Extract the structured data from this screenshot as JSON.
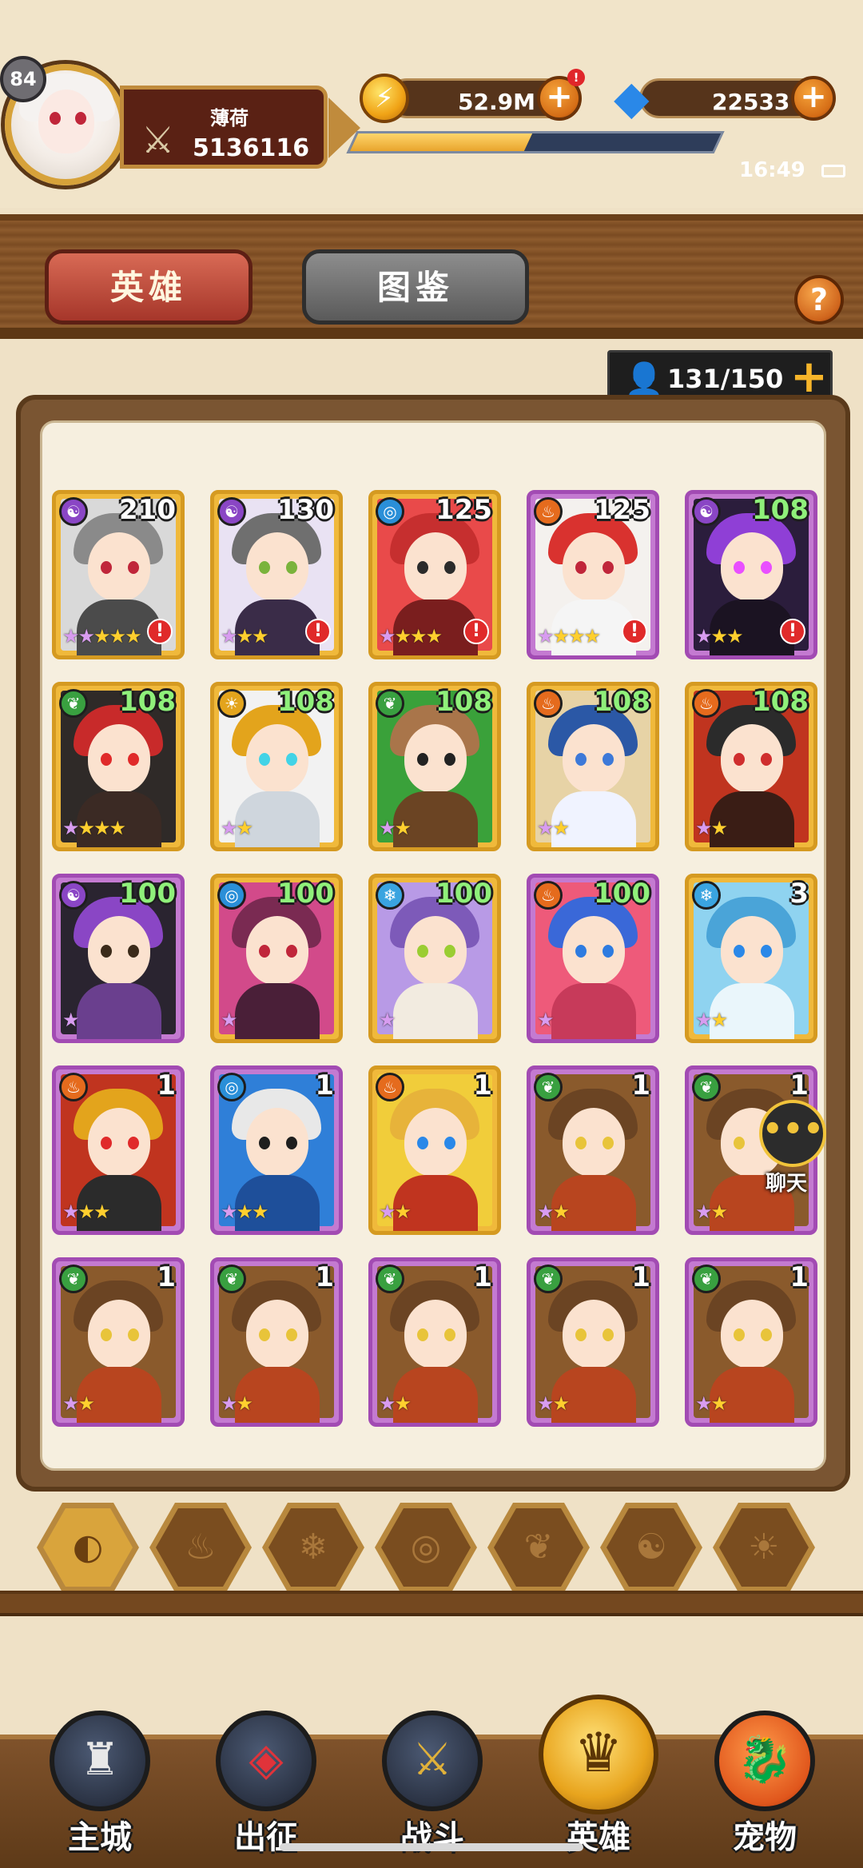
{
  "player": {
    "level": "84",
    "name": "薄荷",
    "power": "5136116"
  },
  "resources": {
    "gold": "52.9M",
    "gold_alert": "!",
    "gems": "22533",
    "exp_progress": 0.48
  },
  "status_bar": {
    "time": "16:49"
  },
  "tabs": {
    "heroes": "英雄",
    "codex": "图鉴",
    "help": "?"
  },
  "roster": {
    "count": "131/150",
    "plus": "+"
  },
  "heroes": [
    {
      "level": "210",
      "element": "dark",
      "stars": "2p3g",
      "alert": true
    },
    {
      "level": "130",
      "element": "dark",
      "stars": "1p2g",
      "alert": true
    },
    {
      "level": "125",
      "element": "water",
      "stars": "1p3g",
      "alert": true
    },
    {
      "level": "125",
      "element": "fire",
      "stars": "1p3g",
      "alert": true
    },
    {
      "level": "108",
      "element": "dark",
      "stars": "1p2g",
      "alert": true
    },
    {
      "level": "108",
      "element": "nature",
      "stars": "1p3g",
      "alert": false
    },
    {
      "level": "108",
      "element": "light",
      "stars": "1p1g",
      "alert": false
    },
    {
      "level": "108",
      "element": "nature",
      "stars": "1p1g",
      "alert": false
    },
    {
      "level": "108",
      "element": "fire",
      "stars": "1p1g",
      "alert": false
    },
    {
      "level": "108",
      "element": "fire",
      "stars": "1p1g",
      "alert": false
    },
    {
      "level": "100",
      "element": "dark",
      "stars": "1p",
      "alert": false
    },
    {
      "level": "100",
      "element": "water",
      "stars": "1p",
      "alert": false
    },
    {
      "level": "100",
      "element": "ice",
      "stars": "1p",
      "alert": false
    },
    {
      "level": "100",
      "element": "fire",
      "stars": "1p",
      "alert": false
    },
    {
      "level": "3",
      "element": "ice",
      "stars": "1p1g",
      "alert": false
    },
    {
      "level": "1",
      "element": "fire",
      "stars": "1p2g",
      "alert": false
    },
    {
      "level": "1",
      "element": "water",
      "stars": "1p2g",
      "alert": false
    },
    {
      "level": "1",
      "element": "fire",
      "stars": "1p1g",
      "alert": false
    },
    {
      "level": "1",
      "element": "nature",
      "stars": "1p1g",
      "alert": false
    },
    {
      "level": "1",
      "element": "nature",
      "stars": "1p1g",
      "alert": false
    },
    {
      "level": "1",
      "element": "nature",
      "stars": "1p1g",
      "alert": false
    },
    {
      "level": "1",
      "element": "nature",
      "stars": "1p1g",
      "alert": false
    },
    {
      "level": "1",
      "element": "nature",
      "stars": "1p1g",
      "alert": false
    },
    {
      "level": "1",
      "element": "nature",
      "stars": "1p1g",
      "alert": false
    },
    {
      "level": "1",
      "element": "nature",
      "stars": "1p1g",
      "alert": false
    }
  ],
  "chat": {
    "label": "聊天"
  },
  "filters": [
    "all-icon",
    "fire-icon",
    "ice-icon",
    "water-icon",
    "nature-icon",
    "dark-icon",
    "light-icon"
  ],
  "nav": [
    {
      "label": "主城",
      "icon": "castle-icon"
    },
    {
      "label": "出征",
      "icon": "expedition-icon"
    },
    {
      "label": "战斗",
      "icon": "battle-shield-icon"
    },
    {
      "label": "英雄",
      "icon": "hero-crest-icon"
    },
    {
      "label": "宠物",
      "icon": "dragon-pet-icon"
    }
  ],
  "colors": {
    "accent_red": "#a6362a",
    "gold": "#f0b93b",
    "purple_frame": "#a24bb3",
    "nature_green": "#39a040",
    "level_green": "#8ff07a"
  }
}
